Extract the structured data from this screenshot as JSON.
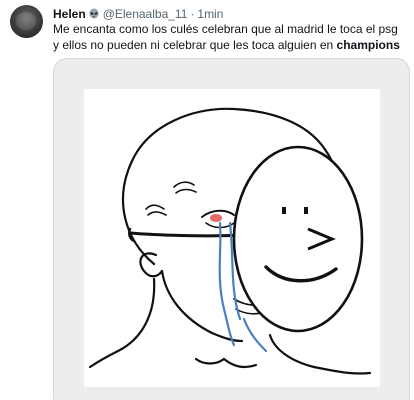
{
  "tweet": {
    "display_name": "Helen",
    "handle": "@Elenaalba_11",
    "separator": "·",
    "time": "1min",
    "text_plain": "Me encanta como los culés celebran que al madrid le toca el psg y ellos no pueden ni celebrar que les toca alguien en ",
    "text_bold": "champions"
  },
  "media": {
    "mask_face": ": >"
  },
  "icons": {
    "avatar": "avatar",
    "name_emoji": "alien-icon"
  }
}
